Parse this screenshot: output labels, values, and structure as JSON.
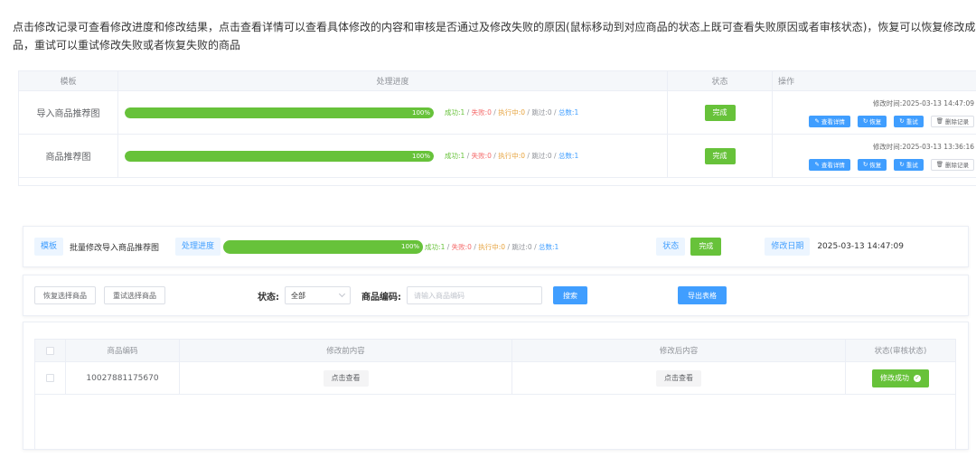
{
  "intro": {
    "line1": "点击修改记录可查看修改进度和修改结果，点击查看详情可以查看具体修改的内容和审核是否通过及修改失败的原因(鼠标移动到对应商品的状态上既可查看失败原因或者审核状态)，恢复可以恢复修改成功的",
    "line2": "品，重试可以重试修改失败或者恢复失败的商品"
  },
  "top_table": {
    "headers": {
      "template": "模板",
      "progress": "处理进度",
      "status": "状态",
      "ops": "操作"
    },
    "rows": [
      {
        "template": "导入商品推荐图",
        "progress": 1.0,
        "percent_label": "100%",
        "stats": {
          "success": "成功:1",
          "fail": "失败:0",
          "running": "执行中:0",
          "skipped": "跳过:0",
          "total": "总数:1"
        },
        "status": "完成",
        "mod_time": "修改时间:2025-03-13 14:47:09",
        "buttons": {
          "detail": "查看详情",
          "restore": "恢复",
          "retry": "重试",
          "delete": "删除记录"
        }
      },
      {
        "template": "商品推荐图",
        "progress": 1.0,
        "percent_label": "100%",
        "stats": {
          "success": "成功:1",
          "fail": "失败:0",
          "running": "执行中:0",
          "skipped": "跳过:0",
          "total": "总数:1"
        },
        "status": "完成",
        "mod_time": "修改时间:2025-03-13 13:36:16",
        "buttons": {
          "detail": "查看详情",
          "restore": "恢复",
          "retry": "重试",
          "delete": "删除记录"
        }
      }
    ]
  },
  "detail": {
    "template_label": "模板",
    "template_value": "批量修改导入商品推荐图",
    "progress_label": "处理进度",
    "progress": 1.0,
    "percent_label": "100%",
    "stats": {
      "success": "成功:1",
      "fail": "失败:0",
      "running": "执行中:0",
      "skipped": "跳过:0",
      "total": "总数:1"
    },
    "status_label": "状态",
    "status_value": "完成",
    "date_label": "修改日期",
    "date_value": "2025-03-13 14:47:09"
  },
  "filters": {
    "restore_selected": "恢复选择商品",
    "retry_selected": "重试选择商品",
    "status_label": "状态:",
    "status_value": "全部",
    "code_label": "商品编码:",
    "code_placeholder": "请输入商品编码",
    "search": "搜索",
    "export": "导出表格"
  },
  "detail_table": {
    "headers": {
      "code": "商品编码",
      "before": "修改前内容",
      "after": "修改后内容",
      "status": "状态(审核状态)"
    },
    "rows": [
      {
        "code": "10027881175670",
        "before_btn": "点击查看",
        "after_btn": "点击查看",
        "status": "修改成功"
      }
    ]
  },
  "colors": {
    "primary": "#409eff",
    "success": "#67c23a",
    "danger": "#f56c6c",
    "warning": "#e6a23c",
    "info": "#909399"
  }
}
